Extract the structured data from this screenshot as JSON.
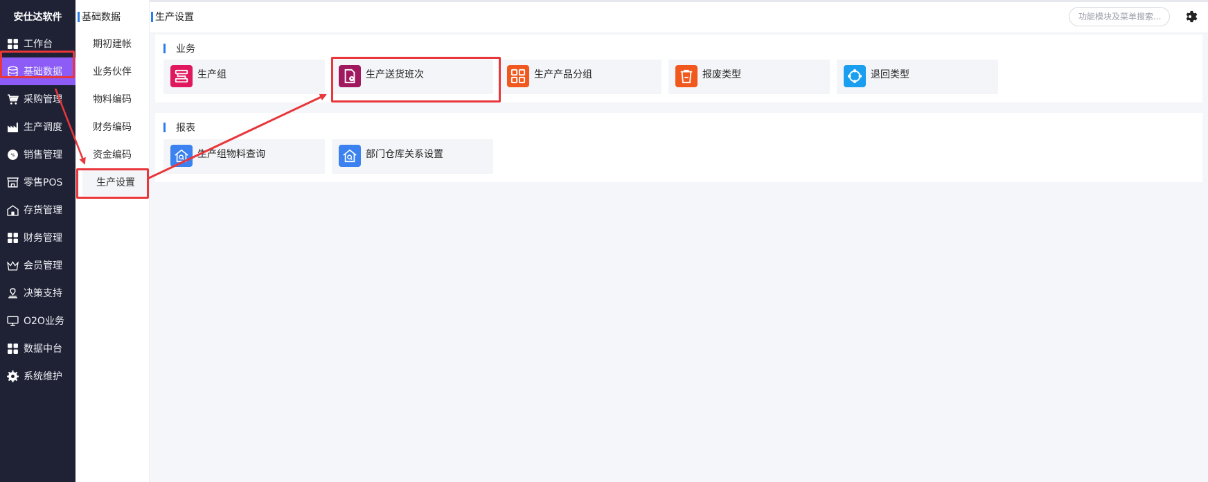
{
  "brand": "安仕达软件",
  "nav": [
    {
      "label": "工作台",
      "icon": "grid-icon"
    },
    {
      "label": "基础数据",
      "icon": "database-icon",
      "active": true
    },
    {
      "label": "采购管理",
      "icon": "cart-icon"
    },
    {
      "label": "生产调度",
      "icon": "factory-icon"
    },
    {
      "label": "销售管理",
      "icon": "sale-badge-icon"
    },
    {
      "label": "零售POS",
      "icon": "store-icon"
    },
    {
      "label": "存货管理",
      "icon": "warehouse-icon"
    },
    {
      "label": "财务管理",
      "icon": "grid-icon"
    },
    {
      "label": "会员管理",
      "icon": "crown-icon"
    },
    {
      "label": "决策支持",
      "icon": "stamp-icon"
    },
    {
      "label": "O2O业务",
      "icon": "monitor-icon"
    },
    {
      "label": "数据中台",
      "icon": "grid-icon"
    },
    {
      "label": "系统维护",
      "icon": "gear-icon"
    }
  ],
  "subnav": {
    "title": "基础数据",
    "items": [
      {
        "label": "期初建帐"
      },
      {
        "label": "业务伙伴"
      },
      {
        "label": "物料编码"
      },
      {
        "label": "财务编码"
      },
      {
        "label": "资金编码"
      },
      {
        "label": "生产设置",
        "active": true
      }
    ]
  },
  "topbar": {
    "title": "生产设置",
    "search_placeholder": "功能模块及菜单搜索..."
  },
  "sections": [
    {
      "title": "业务",
      "cards": [
        {
          "label": "生产组",
          "icon": "production-group-icon",
          "color": "#e0185d"
        },
        {
          "label": "生产送货班次",
          "icon": "delivery-shift-icon",
          "color": "#a0195e"
        },
        {
          "label": "生产产品分组",
          "icon": "product-group-icon",
          "color": "#f0581e"
        },
        {
          "label": "报废类型",
          "icon": "trash-icon",
          "color": "#f0581e"
        },
        {
          "label": "退回类型",
          "icon": "return-type-icon",
          "color": "#1a9ff0"
        }
      ]
    },
    {
      "title": "报表",
      "cards": [
        {
          "label": "生产组物料查询",
          "icon": "home-search-icon",
          "color": "#3b82f0"
        },
        {
          "label": "部门仓库关系设置",
          "icon": "home-search-icon",
          "color": "#3b82f0"
        }
      ]
    }
  ],
  "colors": {
    "nav_bg": "#1f2235",
    "nav_active": "#8d5cf7",
    "accent_bar": "#2b7de9",
    "annotation": "#e8363b"
  }
}
